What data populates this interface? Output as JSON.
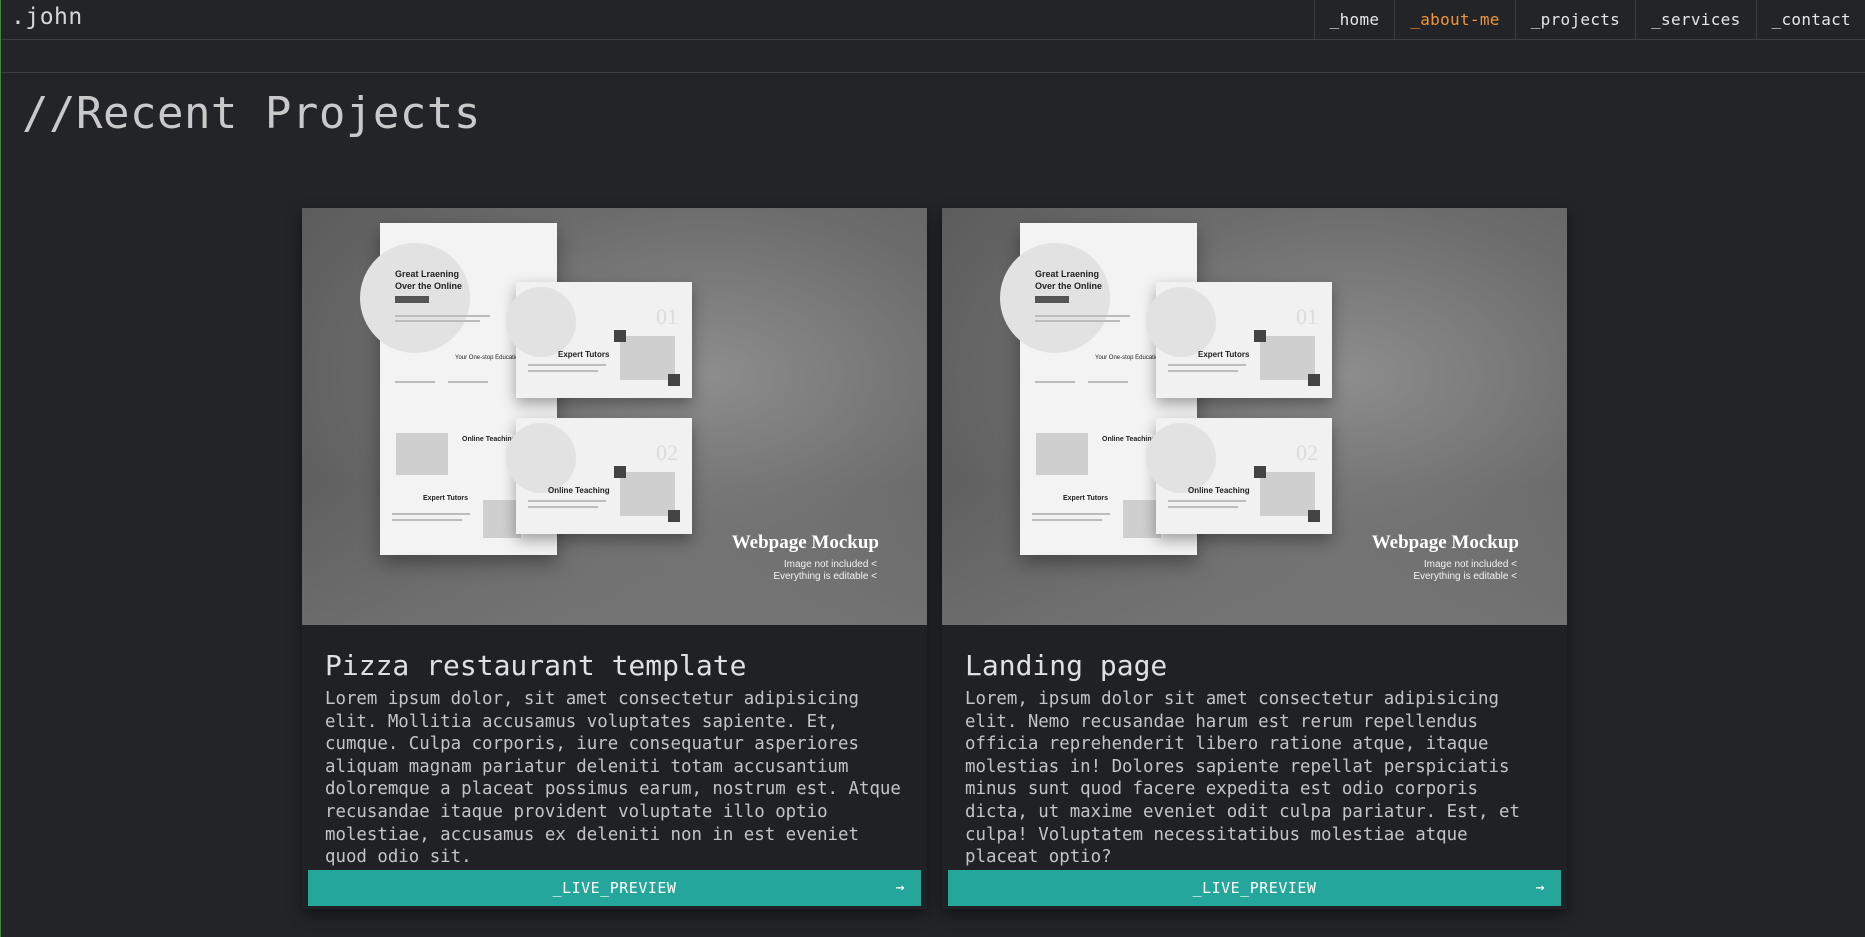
{
  "nav": {
    "logo": ".john",
    "links": [
      {
        "label": "_home",
        "active": false
      },
      {
        "label": "_about-me",
        "active": true
      },
      {
        "label": "_projects",
        "active": false
      },
      {
        "label": "_services",
        "active": false
      },
      {
        "label": "_contact",
        "active": false
      }
    ],
    "active_color": "#f0963a"
  },
  "section": {
    "title": "//Recent Projects"
  },
  "projects": [
    {
      "title": "Pizza restaurant template",
      "description": "Lorem ipsum dolor, sit amet consectetur adipisicing elit. Mollitia accusamus voluptates sapiente. Et, cumque. Culpa corporis, iure consequatur asperiores aliquam magnam pariatur deleniti totam accusantium doloremque a placeat possimus earum, nostrum est. Atque recusandae itaque provident voluptate illo optio molestiae, accusamus ex deleniti non in est eveniet quod odio sit.",
      "button_label": "_LIVE_PREVIEW",
      "button_icon": "arrow-right-icon",
      "thumbnail": {
        "title": "Webpage Mockup",
        "line1": "Image not included <",
        "line2": "Everything is editable <",
        "hero_title_1": "Great Lraening",
        "hero_title_2": "Over the Online",
        "card1_title": "Expert Tutors",
        "card1_num": "01",
        "card2_title": "Online Teaching",
        "card2_num": "02",
        "strip1": "Your One-stop Education",
        "strip2": "Online Teaching",
        "strip3": "Expert Tutors"
      }
    },
    {
      "title": "Landing page",
      "description": "Lorem, ipsum dolor sit amet consectetur adipisicing elit. Nemo recusandae harum est rerum repellendus officia reprehenderit libero ratione atque, itaque molestias in! Dolores sapiente repellat perspiciatis minus sunt quod facere expedita est odio corporis dicta, ut maxime eveniet odit culpa pariatur. Est, et culpa! Voluptatem necessitatibus molestiae atque placeat optio?",
      "button_label": "_LIVE_PREVIEW",
      "button_icon": "arrow-right-icon",
      "thumbnail": {
        "title": "Webpage Mockup",
        "line1": "Image not included <",
        "line2": "Everything is editable <",
        "hero_title_1": "Great Lraening",
        "hero_title_2": "Over the Online",
        "card1_title": "Expert Tutors",
        "card1_num": "01",
        "card2_title": "Online Teaching",
        "card2_num": "02",
        "strip1": "Your One-stop Education",
        "strip2": "Online Teaching",
        "strip3": "Expert Tutors"
      }
    }
  ],
  "colors": {
    "background": "#222428",
    "card": "#1f2124",
    "button": "#24a69a",
    "accent": "#f0963a"
  }
}
